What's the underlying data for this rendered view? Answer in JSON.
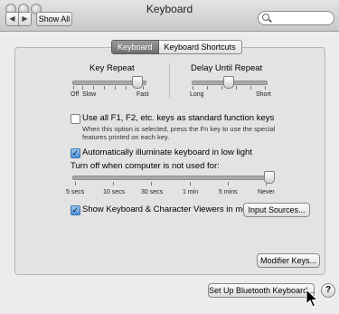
{
  "window": {
    "title": "Keyboard"
  },
  "toolbar": {
    "back_glyph": "◀",
    "forward_glyph": "▶",
    "show_all_label": "Show All",
    "search_placeholder": ""
  },
  "tabs": [
    {
      "label": "Keyboard"
    },
    {
      "label": "Keyboard Shortcuts"
    }
  ],
  "key_repeat": {
    "title": "Key Repeat",
    "ticks": [
      "Off",
      "Slow",
      "Fast"
    ],
    "level": 0.9
  },
  "delay_until_repeat": {
    "title": "Delay Until Repeat",
    "ticks": [
      "Long",
      "Short"
    ],
    "level": 0.5
  },
  "fn_keys": {
    "checked": false,
    "label": "Use all F1, F2, etc. keys as standard function keys",
    "description_line1": "When this option is selected, press the Fn key to use the special",
    "description_line2": "features printed on each key."
  },
  "illuminate": {
    "checked": true,
    "check_glyph": "✓",
    "label": "Automatically illuminate keyboard in low light"
  },
  "turn_off": {
    "title": "Turn off when computer is not used for:",
    "ticks": [
      "5 secs",
      "10 secs",
      "30 secs",
      "1 min",
      "5 mins",
      "Never"
    ],
    "level": 1.0
  },
  "viewers": {
    "checked": true,
    "check_glyph": "✓",
    "label": "Show Keyboard & Character Viewers in menu bar"
  },
  "buttons": {
    "input_sources": "Input Sources...",
    "modifier_keys": "Modifier Keys...",
    "bluetooth_setup": "Set Up Bluetooth Keyboard...",
    "help": "?"
  },
  "colors": {
    "checkbox_checked": "#4b8ed8",
    "tab_active": "#6e6e6e"
  }
}
